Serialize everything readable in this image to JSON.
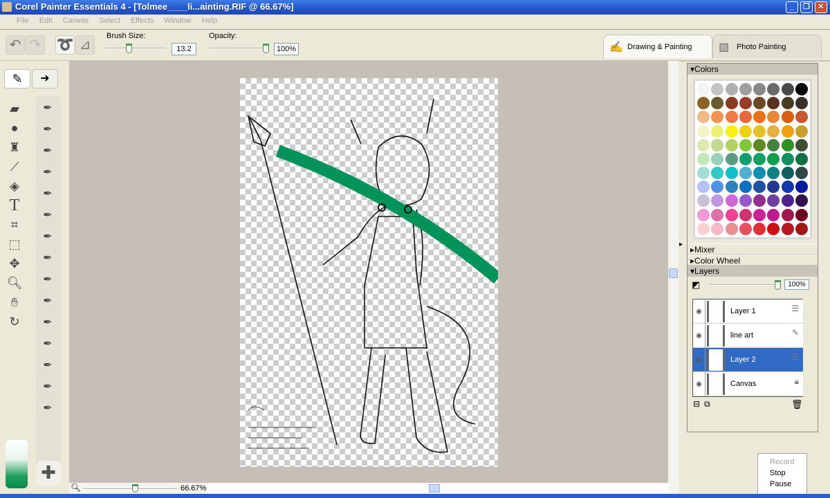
{
  "window": {
    "title": "Corel Painter Essentials 4 - [Tolmee____li...ainting.RIF @ 66.67%]",
    "minimize": "_",
    "restore": "❐",
    "close": "✕"
  },
  "menu": [
    "File",
    "Edit",
    "Canvas",
    "Select",
    "Effects",
    "Window",
    "Help"
  ],
  "toolbar": {
    "brush_size_label": "Brush Size:",
    "brush_size_value": "13.2",
    "brush_size_level": 0.35,
    "opacity_label": "Opacity:",
    "opacity_value": "100%",
    "opacity_level": 1.0
  },
  "workspace_tabs": [
    {
      "label": "Drawing & Painting",
      "active": true
    },
    {
      "label": "Photo Painting",
      "active": false
    }
  ],
  "status": {
    "zoom": "66.67%"
  },
  "panels": {
    "colors": "Colors",
    "mixer": "Mixer",
    "color_wheel": "Color Wheel",
    "layers": "Layers",
    "layer_opacity": "100%"
  },
  "palette": [
    "#f4f4f4",
    "#c4c4c4",
    "#b0b0b0",
    "#a0a0a0",
    "#888888",
    "#6a6a6a",
    "#4a4a4a",
    "#050505",
    "#8a6420",
    "#6a5a30",
    "#8a3a20",
    "#9a3a28",
    "#6a4a20",
    "#5a3020",
    "#4a3a20",
    "#3a3028",
    "#f4b888",
    "#f49050",
    "#f47840",
    "#e86838",
    "#f07018",
    "#e88838",
    "#d86010",
    "#c85830",
    "#f4f4c8",
    "#f0f070",
    "#f8f010",
    "#f0d010",
    "#e8c020",
    "#e8b040",
    "#f0a010",
    "#c8a030",
    "#e0e8b0",
    "#c0d890",
    "#b0d060",
    "#80c838",
    "#608820",
    "#488040",
    "#309020",
    "#405030",
    "#c0e8b8",
    "#98d0b8",
    "#5a9a80",
    "#10a070",
    "#10a060",
    "#10a050",
    "#109060",
    "#107040",
    "#a0dcd8",
    "#30c8c0",
    "#10c0c8",
    "#50b0d0",
    "#1090b0",
    "#108080",
    "#106060",
    "#304848",
    "#b8c0f8",
    "#5090e8",
    "#3080c0",
    "#1070c0",
    "#2050a0",
    "#203890",
    "#1038b0",
    "#0818a0",
    "#c8c0d8",
    "#c098e0",
    "#d068d8",
    "#9858d0",
    "#903090",
    "#7040a0",
    "#502090",
    "#301050",
    "#f098d8",
    "#e070a8",
    "#f04090",
    "#d03070",
    "#d02090",
    "#c01890",
    "#a01850",
    "#700020",
    "#f8d0d0",
    "#f8b8c8",
    "#e89090",
    "#e85060",
    "#e03038",
    "#d01010",
    "#b81820",
    "#a01818"
  ],
  "layers": [
    {
      "name": "Layer 1",
      "selected": false,
      "icon": "layer-stack-icon"
    },
    {
      "name": "line art",
      "selected": false,
      "icon": "pencil-layer-icon"
    },
    {
      "name": "Layer 2",
      "selected": true,
      "icon": "layer-stack-icon"
    },
    {
      "name": "Canvas",
      "selected": false,
      "icon": "lock-icon"
    }
  ],
  "popup": {
    "record": "Record",
    "stop": "Stop",
    "pause": "Pause"
  },
  "colors": {
    "titlebar": "#2456c8",
    "selection": "#316ac5",
    "stroke": "#00935a",
    "canvas_bg": "#c5bfb7"
  }
}
